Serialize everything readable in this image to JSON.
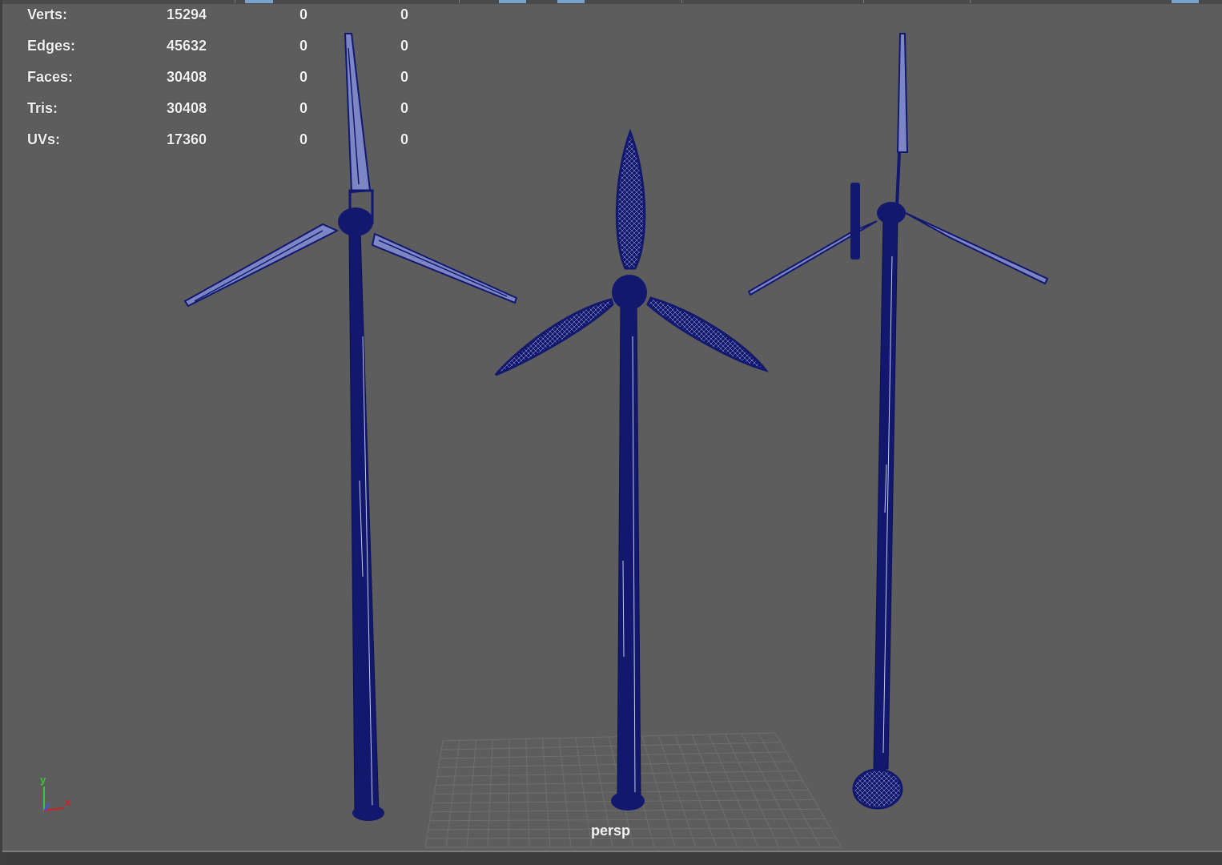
{
  "hud": {
    "rows": [
      {
        "label": "Verts:",
        "v1": "15294",
        "v2": "0",
        "v3": "0"
      },
      {
        "label": "Edges:",
        "v1": "45632",
        "v2": "0",
        "v3": "0"
      },
      {
        "label": "Faces:",
        "v1": "30408",
        "v2": "0",
        "v3": "0"
      },
      {
        "label": "Tris:",
        "v1": "30408",
        "v2": "0",
        "v3": "0"
      },
      {
        "label": "UVs:",
        "v1": "17360",
        "v2": "0",
        "v3": "0"
      }
    ]
  },
  "viewport": {
    "camera_label": "persp",
    "background_color": "#5d5d5d",
    "wireframe_color": "#11186e",
    "grid_color": "#6e6e6e"
  },
  "axis_gizmo": {
    "y_label": "y",
    "x_label": "x",
    "y_color": "#33cc33",
    "x_color": "#cc2222",
    "z_color": "#3355ff"
  }
}
